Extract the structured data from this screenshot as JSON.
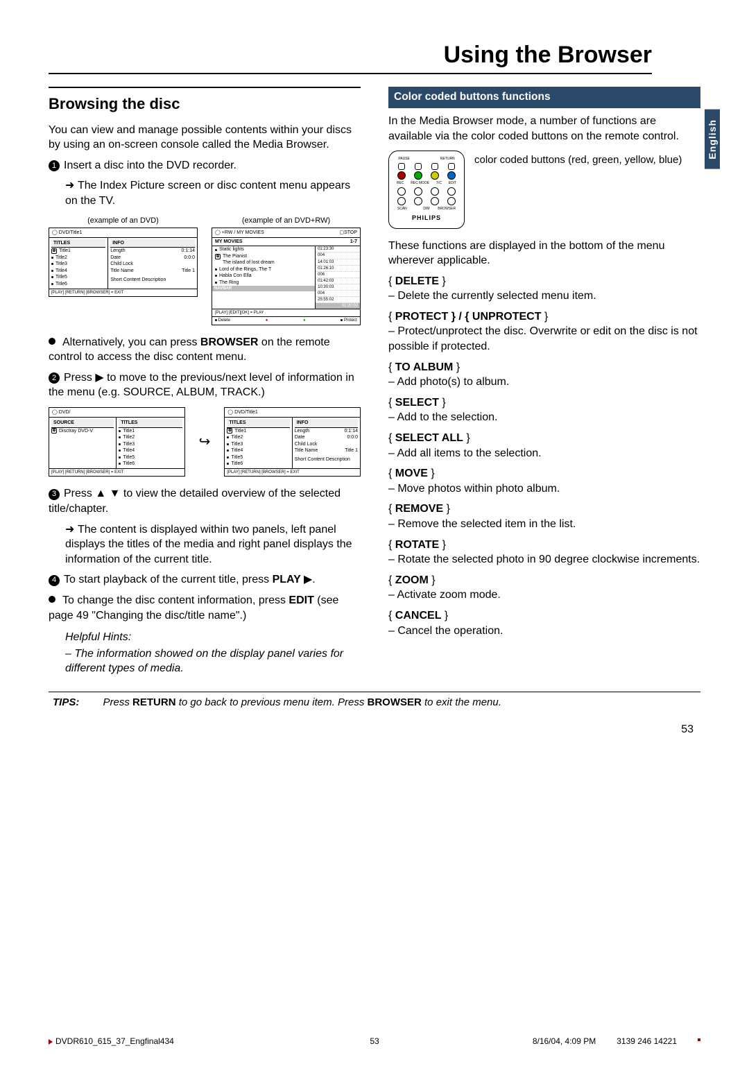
{
  "pageTitle": "Using the Browser",
  "sideTab": "English",
  "left": {
    "heading": "Browsing the disc",
    "intro": "You can view and manage possible contents within your discs by using an on-screen console called the Media Browser.",
    "step1a": "Insert a disc into the DVD recorder.",
    "step1b": "The Index Picture screen or disc content menu appears on the TV.",
    "figLabel1": "(example of an DVD)",
    "figLabel2": "(example of an DVD+RW)",
    "alt": "Alternatively, you can press ",
    "altBold": "BROWSER",
    "altRest": " on the remote control to access the disc content menu.",
    "step2a": "Press ",
    "step2b": " to move to the previous/next level of information in the menu (e.g. SOURCE, ALBUM, TRACK.)",
    "step3a": "Press ",
    "step3b": " to view the detailed overview of the selected title/chapter.",
    "step3c": "The content is displayed within two panels, left panel displays the titles of the media and right panel displays the information of the current title.",
    "step4a": "To start playback of the current title, press ",
    "step4bold": "PLAY ",
    "editA": "To change the disc content information, press ",
    "editBold": "EDIT",
    "editB": " (see page 49 \"Changing the disc/title name\".)",
    "hintsLabel": "Helpful Hints:",
    "hints": "– The information showed on the display panel varies for different types of media."
  },
  "fig": {
    "dvd": {
      "topL": "DVD/Title1",
      "tabTitles": "TITLES",
      "tabInfo": "INFO",
      "titles": [
        "Title1",
        "Title2",
        "Title3",
        "Title4",
        "Title5",
        "Title6"
      ],
      "info": {
        "lengthL": "Length",
        "lengthV": "0:1:14",
        "dateL": "Date",
        "dateV": "0:0:0",
        "childL": "Child Lock",
        "nameL": "Title Name",
        "nameV": "Title 1",
        "desc": "Short Content Description"
      },
      "foot": "[PLAY] [RETURN] [BROWSER] = EXIT"
    },
    "rw": {
      "topL": "+RW / MY MOVIES",
      "topR": "STOP",
      "subL": "MY MOVIES",
      "subR": "1-7",
      "items": [
        "Static lights",
        "The Pianist",
        "The island of lost dream",
        "Lord of the Rings, The T",
        "Habla Con Ella",
        "The Ring"
      ],
      "times": [
        "01:23:30",
        "004",
        "14:01:03",
        "01:26:10",
        "006",
        "01:42:03",
        "10:30:03",
        "004",
        "25:55:02"
      ],
      "navbar": "NAVBAR",
      "total": "01:20:00",
      "footEdit": "[PLAY] [EDIT][OK] = PLAY",
      "footDel": "Delete",
      "footProt": "Protect"
    },
    "src": {
      "top": "DVD/",
      "headA": "SOURCE",
      "headB": "TITLES",
      "left": "Disctray DVD-V",
      "titles": [
        "Title1",
        "Title2",
        "Title3",
        "Title4",
        "Title5",
        "Title6"
      ],
      "foot": "[PLAY] [RETURN] [BROWSER] = EXIT"
    },
    "info": {
      "top": "DVD/Title1",
      "headA": "TITLES",
      "headB": "INFO",
      "titles": [
        "Title1",
        "Title2",
        "Title3",
        "Title4",
        "Title5",
        "Title6"
      ],
      "lengthL": "Length",
      "lengthV": "0:1:14",
      "dateL": "Date",
      "dateV": "0:0:0",
      "childL": "Child Lock",
      "nameL": "Title Name",
      "nameV": "Title 1",
      "desc": "Short Content Description",
      "foot": "[PLAY] [RETURN] [BROWSER] = EXIT"
    }
  },
  "remote": {
    "topLabels": [
      "PAUSE",
      "",
      "",
      "RETURN"
    ],
    "sideNote": "color coded buttons (red, green, yellow, blue)",
    "midLabels": [
      "REC",
      "REC MODE",
      "T/C",
      "EDIT"
    ],
    "bottomLabels": [
      "SCAN",
      "",
      "DIM",
      "BROWSER"
    ],
    "brand": "PHILIPS"
  },
  "right": {
    "barTitle": "Color coded buttons functions",
    "intro": "In the Media Browser mode, a number of functions are available via the color coded buttons on the remote control.",
    "displayed": "These functions are displayed in the bottom of the menu wherever applicable.",
    "funcs": [
      {
        "name": "DELETE",
        "desc": "–  Delete the currently selected menu item."
      },
      {
        "name": "PROTECT } / { UNPROTECT",
        "desc": "–  Protect/unprotect the disc.  Overwrite or edit on the disc is not possible if protected."
      },
      {
        "name": "TO ALBUM",
        "desc": "–  Add photo(s) to album."
      },
      {
        "name": "SELECT",
        "desc": "–  Add to the selection."
      },
      {
        "name": "SELECT ALL",
        "desc": "–  Add all items to the selection."
      },
      {
        "name": "MOVE",
        "desc": "–  Move photos within photo album."
      },
      {
        "name": "REMOVE",
        "desc": "–  Remove the selected item in the list."
      },
      {
        "name": "ROTATE",
        "desc": "–  Rotate the selected photo in 90 degree clockwise increments."
      },
      {
        "name": "ZOOM",
        "desc": "–  Activate zoom mode."
      },
      {
        "name": "CANCEL",
        "desc": "–  Cancel the operation."
      }
    ]
  },
  "tips": {
    "label": "TIPS:",
    "t1": "Press ",
    "b1": "RETURN",
    "t2": " to go back to previous menu item.  Press ",
    "b2": "BROWSER",
    "t3": " to exit the menu."
  },
  "pageNum": "53",
  "footer": {
    "left": "DVDR610_615_37_Engfinal434",
    "center": "53",
    "date": "8/16/04, 4:09 PM",
    "right": "3139 246 14221"
  }
}
